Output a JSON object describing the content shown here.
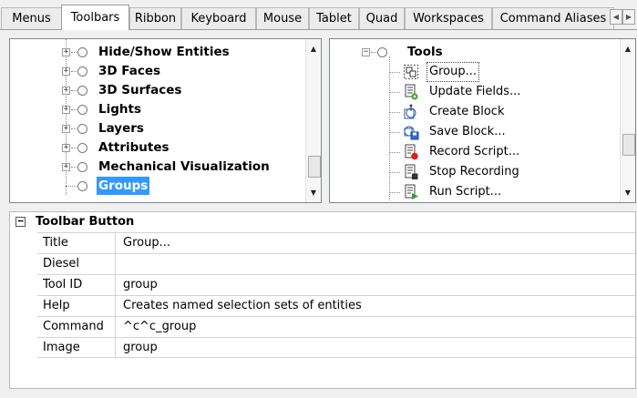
{
  "tabs": [
    "Menus",
    "Toolbars",
    "Ribbon",
    "Keyboard",
    "Mouse",
    "Tablet",
    "Quad",
    "Workspaces",
    "Command Aliases"
  ],
  "active_tab": "Toolbars",
  "toolbar_tree": {
    "items": [
      {
        "label": "Hide/Show Entities",
        "expandable": true
      },
      {
        "label": "3D Faces",
        "expandable": true
      },
      {
        "label": "3D Surfaces",
        "expandable": true
      },
      {
        "label": "Lights",
        "expandable": true
      },
      {
        "label": "Layers",
        "expandable": true
      },
      {
        "label": "Attributes",
        "expandable": true
      },
      {
        "label": "Mechanical Visualization",
        "expandable": true
      },
      {
        "label": "Groups",
        "expandable": false,
        "selected": true
      }
    ]
  },
  "tools_tree": {
    "root_label": "Tools",
    "items": [
      {
        "label": "Group...",
        "icon": "group-icon",
        "focused": true
      },
      {
        "label": "Update Fields...",
        "icon": "update-fields-icon"
      },
      {
        "label": "Create Block",
        "icon": "create-block-icon"
      },
      {
        "label": "Save Block...",
        "icon": "save-block-icon"
      },
      {
        "label": "Record Script...",
        "icon": "record-script-icon"
      },
      {
        "label": "Stop Recording",
        "icon": "stop-recording-icon"
      },
      {
        "label": "Run Script...",
        "icon": "run-script-icon"
      }
    ]
  },
  "properties": {
    "header": "Toolbar Button",
    "rows": [
      {
        "name": "Title",
        "value": "Group..."
      },
      {
        "name": "Diesel",
        "value": ""
      },
      {
        "name": "Tool ID",
        "value": "group"
      },
      {
        "name": "Help",
        "value": "Creates named selection sets of entities"
      },
      {
        "name": "Command",
        "value": "^c^c_group"
      },
      {
        "name": "Image",
        "value": "group"
      }
    ]
  },
  "colors": {
    "selection": "#3399ff",
    "border": "#828790"
  }
}
